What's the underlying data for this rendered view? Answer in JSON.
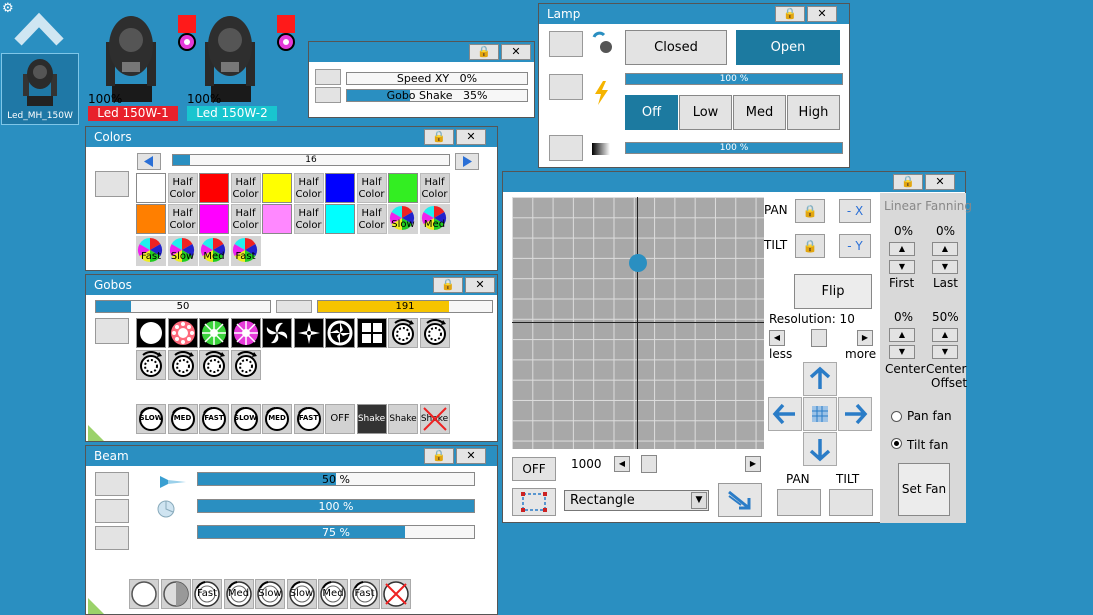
{
  "colors_theme": {
    "accent": "#2a8fc1",
    "background": "#2a8fc1",
    "selected_tab": "#1c7aa0",
    "fixture1_badge": "#e8212b",
    "fixture2_badge": "#19c5cf"
  },
  "sidebar": {
    "device_label": "Led_MH_150W"
  },
  "fixtures": [
    {
      "level": "100%",
      "name": "Led 150W-1",
      "badge_color": "#e8212b"
    },
    {
      "level": "100%",
      "name": "Led 150W-2",
      "badge_color": "#19c5cf"
    }
  ],
  "small_window": {
    "rows": [
      {
        "label": "Speed XY",
        "value": "0%",
        "fill": 0
      },
      {
        "label": "Gobo Shake",
        "value": "35%",
        "fill": 0.35
      }
    ]
  },
  "lamp": {
    "title": "Lamp",
    "closed_label": "Closed",
    "open_label": "Open",
    "intensity": "100 %",
    "off_label": "Off",
    "low_label": "Low",
    "med_label": "Med",
    "high_label": "High",
    "dimmer": "100 %"
  },
  "colors_win": {
    "title": "Colors",
    "slider_value": "16",
    "slider_fill": 0.06,
    "half_label_1": "Half",
    "half_label_2": "Color",
    "swatches": [
      "#ffffff",
      "#ff0000",
      "#ffff00",
      "#0000ff",
      "#33ee22",
      "#ff7f00",
      "#ff00ff",
      "#ff88ff",
      "#00ffff"
    ],
    "wheel_labels": [
      "Slow",
      "Med",
      "Fast",
      "Slow",
      "Med",
      "Fast"
    ]
  },
  "gobos": {
    "title": "Gobos",
    "bar1_value": "50",
    "bar1_fill": 0.2,
    "bar2_value": "191",
    "bar2_fill": 0.75,
    "rot_labels": [
      "SLOW",
      "MED",
      "FAST",
      "SLOW",
      "MED",
      "FAST"
    ],
    "off_label": "OFF",
    "shake_label": "Shake"
  },
  "beam": {
    "title": "Beam",
    "bars": [
      {
        "text": "50 %",
        "fill": 0.5
      },
      {
        "text": "100 %",
        "fill": 1.0
      },
      {
        "text": "75 %",
        "fill": 0.75
      }
    ],
    "bottom_labels": [
      "Fast",
      "Med",
      "Slow",
      "Slow",
      "Med",
      "Fast"
    ]
  },
  "position": {
    "pan_label": "PAN",
    "tilt_label": "TILT",
    "minus_x": "- X",
    "minus_y": "- Y",
    "flip_label": "Flip",
    "resolution_label": "Resolution: 10",
    "less_label": "less",
    "more_label": "more",
    "off_label": "OFF",
    "speed_value": "1000",
    "shape_selected": "Rectangle",
    "pan_bottom": "PAN",
    "tilt_bottom": "TILT",
    "dot": {
      "pan": 0.5,
      "tilt": 0.26
    }
  },
  "fanning": {
    "title": "Linear Fanning",
    "first_value": "0%",
    "last_value": "0%",
    "first_label": "First",
    "last_label": "Last",
    "center_value": "0%",
    "offset_value": "50%",
    "center_label": "Center",
    "center_offset_label_1": "Center",
    "center_offset_label_2": "Offset",
    "pan_fan_label": "Pan fan",
    "tilt_fan_label": "Tilt fan",
    "tilt_fan_selected": true,
    "set_fan_label": "Set Fan"
  }
}
